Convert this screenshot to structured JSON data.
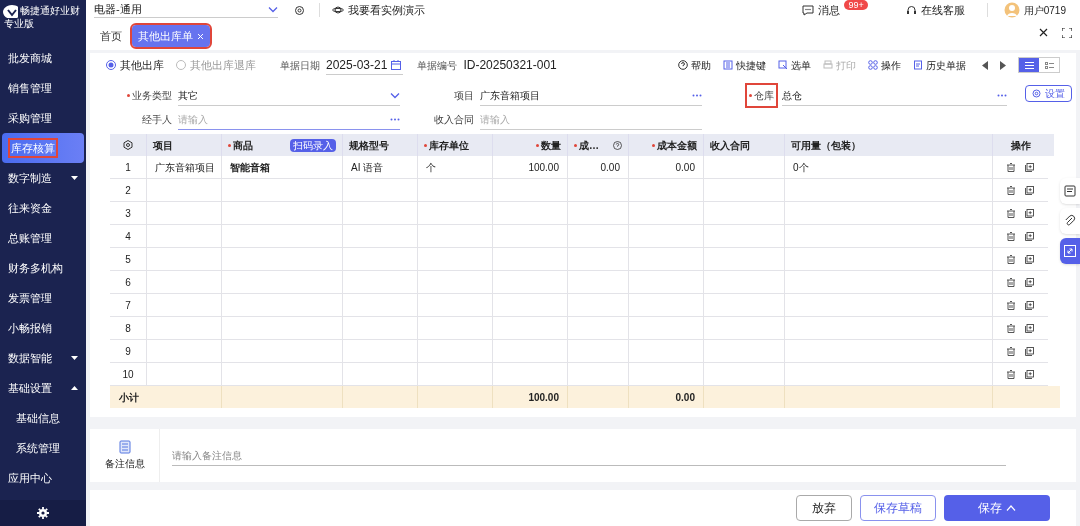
{
  "sidebar": {
    "logo_text": "畅捷通好业财",
    "edition": "专业版",
    "items": [
      {
        "label": "批发商城",
        "selected": false
      },
      {
        "label": "销售管理",
        "selected": false
      },
      {
        "label": "采购管理",
        "selected": false
      },
      {
        "label": "库存核算",
        "selected": true,
        "highlighted": true
      },
      {
        "label": "数字制造",
        "selected": false,
        "expanded": false
      },
      {
        "label": "往来资金",
        "selected": false
      },
      {
        "label": "总账管理",
        "selected": false
      },
      {
        "label": "财务多机构",
        "selected": false
      },
      {
        "label": "发票管理",
        "selected": false
      },
      {
        "label": "小畅报销",
        "selected": false
      },
      {
        "label": "数据智能",
        "selected": false,
        "expanded": false
      },
      {
        "label": "基础设置",
        "selected": false,
        "expanded": true,
        "children": [
          {
            "label": "基础信息",
            "selected": false
          },
          {
            "label": "系统管理",
            "selected": false
          }
        ]
      },
      {
        "label": "应用中心",
        "selected": false
      }
    ]
  },
  "top_bar": {
    "company": "电器-通用",
    "demo_link": "我要看实例演示",
    "messages": {
      "label": "消息",
      "badge": "99+"
    },
    "support": "在线客服",
    "user": "用户0719"
  },
  "tabs": [
    {
      "label": "首页",
      "selected": false,
      "closable": false,
      "highlighted": false
    },
    {
      "label": "其他出库单",
      "selected": true,
      "closable": true,
      "highlighted": true
    }
  ],
  "doc_types": [
    {
      "label": "其他出库",
      "selected": true
    },
    {
      "label": "其他出库退库",
      "selected": false
    }
  ],
  "header_fields": [
    {
      "label": "单据日期",
      "value": "2025-03-21",
      "kind": "date"
    },
    {
      "label": "单据编号",
      "value": "ID-20250321-001",
      "kind": "text"
    }
  ],
  "toolbar": [
    {
      "label": "帮助",
      "kind": "help",
      "disabled": false
    },
    {
      "label": "快捷键",
      "kind": "keys",
      "disabled": false
    },
    {
      "label": "选单",
      "kind": "pick",
      "disabled": false
    },
    {
      "label": "打印",
      "kind": "print",
      "disabled": true
    },
    {
      "label": "操作",
      "kind": "ops",
      "disabled": false
    },
    {
      "label": "历史单据",
      "kind": "history",
      "disabled": false
    }
  ],
  "view_modes": [
    {
      "kind": "list",
      "selected": true
    },
    {
      "kind": "detail",
      "selected": false
    }
  ],
  "form_fields": [
    {
      "label": "业务类型",
      "required": true,
      "value": "其它",
      "kind": "select",
      "highlighted": false
    },
    {
      "label": "项目",
      "required": false,
      "value": "广东音箱项目",
      "kind": "lookup",
      "highlighted": false
    },
    {
      "label": "仓库",
      "required": true,
      "value": "总仓",
      "kind": "lookup",
      "highlighted": true
    },
    {
      "label": "经手人",
      "required": false,
      "placeholder": "请输入",
      "kind": "lookup",
      "highlighted": false
    },
    {
      "label": "收入合同",
      "required": false,
      "placeholder": "请输入",
      "kind": "text",
      "highlighted": false
    }
  ],
  "settings_button": "设置",
  "table": {
    "columns": [
      {
        "label": "项目",
        "required": false,
        "kind": "text"
      },
      {
        "label": "商品",
        "required": true,
        "kind": "text",
        "badge": "扫码录入"
      },
      {
        "label": "规格型号",
        "required": false,
        "kind": "text"
      },
      {
        "label": "库存单位",
        "required": true,
        "kind": "text"
      },
      {
        "label": "数量",
        "required": true,
        "kind": "number"
      },
      {
        "label": "成…",
        "required": true,
        "kind": "number",
        "help": true
      },
      {
        "label": "成本金额",
        "required": true,
        "kind": "number"
      },
      {
        "label": "收入合同",
        "required": false,
        "kind": "text"
      },
      {
        "label": "可用量（包装）",
        "required": false,
        "kind": "text"
      }
    ],
    "operations_label": "操作",
    "rows": [
      {
        "number": "1",
        "values": {
          "column_1": "广东音箱项目",
          "column_2": "智能音箱",
          "column_3": "AI 语音",
          "column_4": "个",
          "column_5": "100.00",
          "column_6": "0.00",
          "column_7": "0.00",
          "column_9": "0个"
        }
      },
      {
        "number": "2",
        "values": {}
      },
      {
        "number": "3",
        "values": {}
      },
      {
        "number": "4",
        "values": {}
      },
      {
        "number": "5",
        "values": {}
      },
      {
        "number": "6",
        "values": {}
      },
      {
        "number": "7",
        "values": {}
      },
      {
        "number": "8",
        "values": {}
      },
      {
        "number": "9",
        "values": {}
      },
      {
        "number": "10",
        "values": {}
      }
    ],
    "subtotal": {
      "label": "小计",
      "values": {
        "column_5": "100.00",
        "column_7": "0.00"
      }
    }
  },
  "side_tools": [
    {
      "kind": "draft",
      "selected": false
    },
    {
      "kind": "attach",
      "selected": false
    },
    {
      "kind": "expand",
      "selected": true
    }
  ],
  "remark": {
    "label": "备注信息",
    "placeholder": "请输入备注信息"
  },
  "actions": [
    {
      "label": "放弃",
      "kind": "plain",
      "caret": false
    },
    {
      "label": "保存草稿",
      "kind": "outline",
      "caret": false
    },
    {
      "label": "保存",
      "kind": "primary",
      "caret": true
    }
  ]
}
